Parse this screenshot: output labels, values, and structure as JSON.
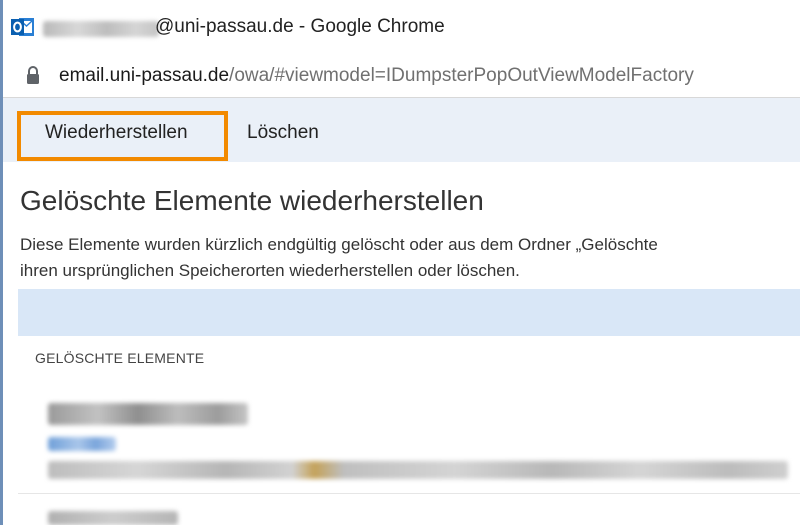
{
  "window": {
    "title_suffix": "@uni-passau.de - Google Chrome"
  },
  "address_bar": {
    "host": "email.uni-passau.de",
    "path": "/owa/#viewmodel=IDumpsterPopOutViewModelFactory"
  },
  "toolbar": {
    "restore_label": "Wiederherstellen",
    "delete_label": "Löschen"
  },
  "page": {
    "title": "Gelöschte Elemente wiederherstellen",
    "description_line1": "Diese Elemente wurden kürzlich endgültig gelöscht oder aus dem Ordner „Gelöschte",
    "description_line2": "ihren ursprünglichen Speicherorten wiederherstellen oder löschen."
  },
  "list": {
    "section_header": "GELÖSCHTE ELEMENTE"
  },
  "colors": {
    "highlight": "#f28a00",
    "toolbar_bg": "#eaf0f8",
    "band_bg": "#d9e7f7",
    "outlook_blue": "#0072c6"
  }
}
